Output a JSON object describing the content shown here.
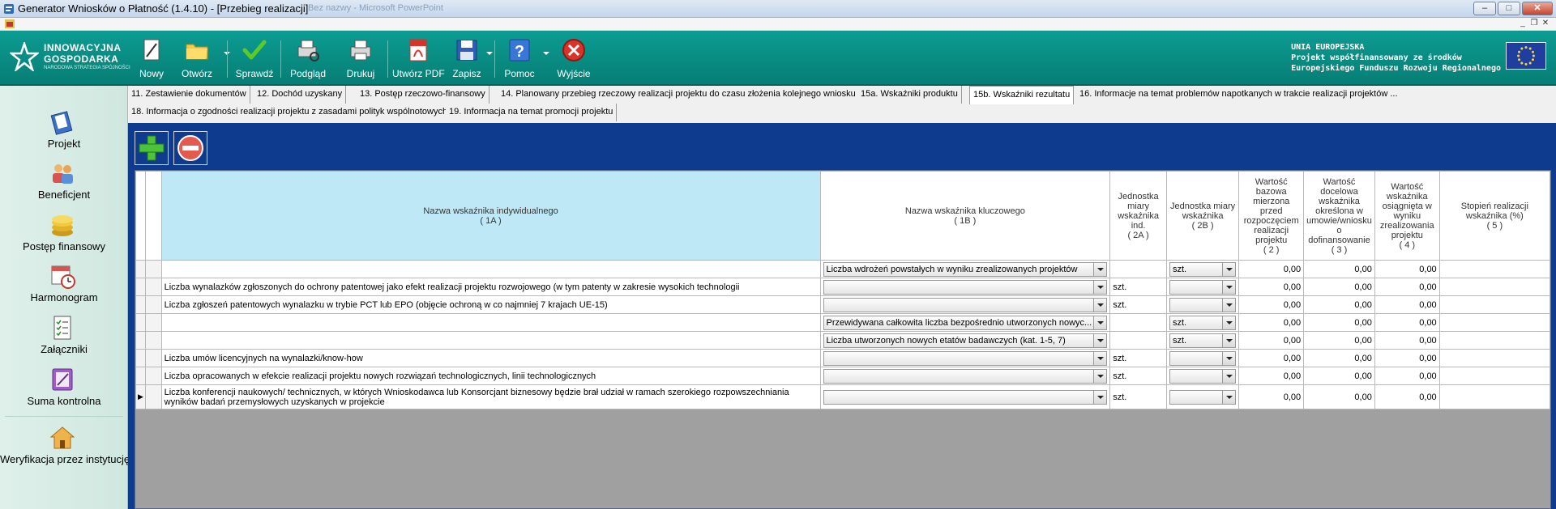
{
  "window": {
    "title": "Generator Wniosków o Płatność (1.4.10) - [Przebieg realizacji]",
    "ghost_text": "Bez nazwy - Microsoft PowerPoint"
  },
  "toolbar": {
    "logo_line1": "INNOWACYJNA",
    "logo_line2": "GOSPODARKA",
    "logo_line3": "NARODOWA STRATEGIA SPÓJNOŚCI",
    "buttons": [
      {
        "label": "Nowy",
        "icon": "new-document-icon"
      },
      {
        "label": "Otwórz",
        "icon": "open-folder-icon"
      },
      {
        "label": "Sprawdź",
        "icon": "check-icon"
      },
      {
        "label": "Podgląd",
        "icon": "print-preview-icon"
      },
      {
        "label": "Drukuj",
        "icon": "printer-icon"
      },
      {
        "label": "Utwórz PDF",
        "icon": "pdf-icon"
      },
      {
        "label": "Zapisz",
        "icon": "save-disk-icon"
      },
      {
        "label": "Pomoc",
        "icon": "help-icon"
      },
      {
        "label": "Wyjście",
        "icon": "exit-icon"
      }
    ],
    "eu_line1": "UNIA EUROPEJSKA",
    "eu_line2": "Projekt współfinansowany ze środków",
    "eu_line3": "Europejskiego Funduszu Rozwoju Regionalnego"
  },
  "sidebar": {
    "items": [
      {
        "label": "Projekt",
        "icon": "project-book-icon"
      },
      {
        "label": "Beneficjent",
        "icon": "beneficiary-people-icon"
      },
      {
        "label": "Postęp finansowy",
        "icon": "coins-icon"
      },
      {
        "label": "Harmonogram",
        "icon": "calendar-clock-icon"
      },
      {
        "label": "Załączniki",
        "icon": "attachments-list-icon"
      },
      {
        "label": "Suma kontrolna",
        "icon": "checksum-icon"
      },
      {
        "label": "Weryfikacja przez instytucję",
        "icon": "institution-house-icon"
      }
    ]
  },
  "tabs": {
    "row1": [
      "11. Zestawienie dokumentów",
      "12. Dochód uzyskany",
      "13. Postęp rzeczowo-finansowy",
      "14. Planowany przebieg rzeczowy realizacji projektu do czasu złożenia kolejnego wniosku",
      "15a. Wskaźniki produktu",
      "15b. Wskaźniki rezultatu",
      "16. Informacje na temat problemów napotkanych w trakcie realizacji projektów ..."
    ],
    "row2": [
      "18. Informacja o zgodności realizacji projektu z zasadami polityk wspólnotowych",
      "19. Informacja na temat promocji projektu"
    ],
    "active": "15b. Wskaźniki rezultatu"
  },
  "grid": {
    "headers": [
      "Nazwa wskaźnika indywidualnego\n( 1A )",
      "Nazwa wskaźnika kluczowego\n( 1B )",
      "Jednostka miary wskaźnika ind.\n( 2A )",
      "Jednostka miary wskaźnika\n( 2B )",
      "Wartość bazowa mierzona przed rozpoczęciem realizacji projektu\n( 2 )",
      "Wartość docelowa wskaźnika określona w umowie/wniosku o dofinansowanie\n( 3 )",
      "Wartość wskaźnika osiągnięta w wyniku zrealizowania projektu\n( 4 )",
      "Stopień realizacji wskaźnika (%)\n( 5 )"
    ],
    "rows": [
      {
        "c1a": "",
        "c1b": "Liczba wdrożeń powstałych w wyniku zrealizowanych projektów",
        "c2a": "",
        "c2b": "szt.",
        "v2": "0,00",
        "v3": "0,00",
        "v4": "0,00",
        "v5": "",
        "marker": ""
      },
      {
        "c1a": "Liczba wynalazków zgłoszonych do ochrony patentowej jako efekt realizacji projektu rozwojowego (w tym patenty w zakresie wysokich technologii",
        "c1b": "",
        "c2a": "szt.",
        "c2b": "",
        "v2": "0,00",
        "v3": "0,00",
        "v4": "0,00",
        "v5": "",
        "marker": ""
      },
      {
        "c1a": "Liczba zgłoszeń patentowych wynalazku w trybie PCT lub EPO (objęcie ochroną w co najmniej 7 krajach UE-15)",
        "c1b": "",
        "c2a": "szt.",
        "c2b": "",
        "v2": "0,00",
        "v3": "0,00",
        "v4": "0,00",
        "v5": "",
        "marker": ""
      },
      {
        "c1a": "",
        "c1b": "Przewidywana całkowita liczba bezpośrednio utworzonych nowyc...",
        "c2a": "",
        "c2b": "szt.",
        "v2": "0,00",
        "v3": "0,00",
        "v4": "0,00",
        "v5": "",
        "marker": ""
      },
      {
        "c1a": "",
        "c1b": "Liczba utworzonych nowych etatów badawczych (kat. 1-5, 7)",
        "c2a": "",
        "c2b": "szt.",
        "v2": "0,00",
        "v3": "0,00",
        "v4": "0,00",
        "v5": "",
        "marker": ""
      },
      {
        "c1a": "Liczba umów licencyjnych na wynalazki/know-how",
        "c1b": "",
        "c2a": "szt.",
        "c2b": "",
        "v2": "0,00",
        "v3": "0,00",
        "v4": "0,00",
        "v5": "",
        "marker": ""
      },
      {
        "c1a": "Liczba opracowanych w efekcie realizacji projektu nowych rozwiązań technologicznych, linii technologicznych",
        "c1b": "",
        "c2a": "szt.",
        "c2b": "",
        "v2": "0,00",
        "v3": "0,00",
        "v4": "0,00",
        "v5": "",
        "marker": ""
      },
      {
        "c1a": "Liczba konferencji naukowych/ technicznych, w których Wnioskodawca lub Konsorcjant biznesowy będzie brał udział w ramach szerokiego rozpowszechniania wyników badań przemysłowych uzyskanych w projekcie",
        "c1b": "",
        "c2a": "szt.",
        "c2b": "",
        "v2": "0,00",
        "v3": "0,00",
        "v4": "0,00",
        "v5": "",
        "marker": "▶"
      }
    ]
  },
  "colors": {
    "toolbar": "#0a8f86",
    "panel": "#0e3b8e",
    "sidebar": "#d6ebe4",
    "header_highlight": "#bfe8f7"
  }
}
